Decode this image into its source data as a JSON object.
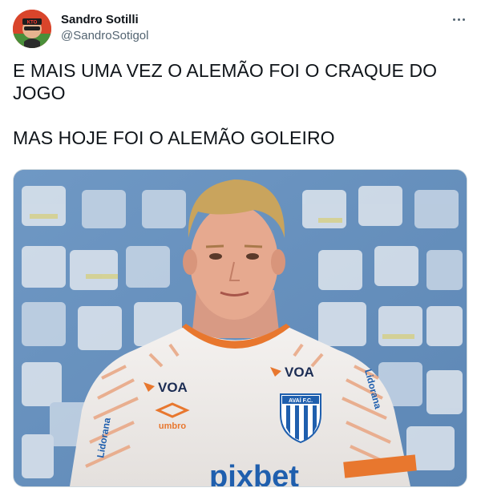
{
  "tweet": {
    "display_name": "Sandro Sotilli",
    "handle": "@SandroSotigol",
    "more_icon": "more-horizontal-icon",
    "text_lines": [
      "E MAIS UMA VEZ O ALEMÃO FOI O CRAQUE DO JOGO",
      "MAS HOJE FOI O ALEMÃO GOLEIRO"
    ],
    "avatar_badge": "KTO"
  },
  "photo": {
    "sponsor_left": "VOA",
    "sponsor_right": "VOA",
    "kit_brand": "umbro",
    "crest": "AVAÍ F.C.",
    "sleeve_sponsor": "Lidorana",
    "chest_sponsor": "pixbet"
  },
  "colors": {
    "accent_orange": "#e8772e",
    "crest_blue": "#1f5fae"
  }
}
